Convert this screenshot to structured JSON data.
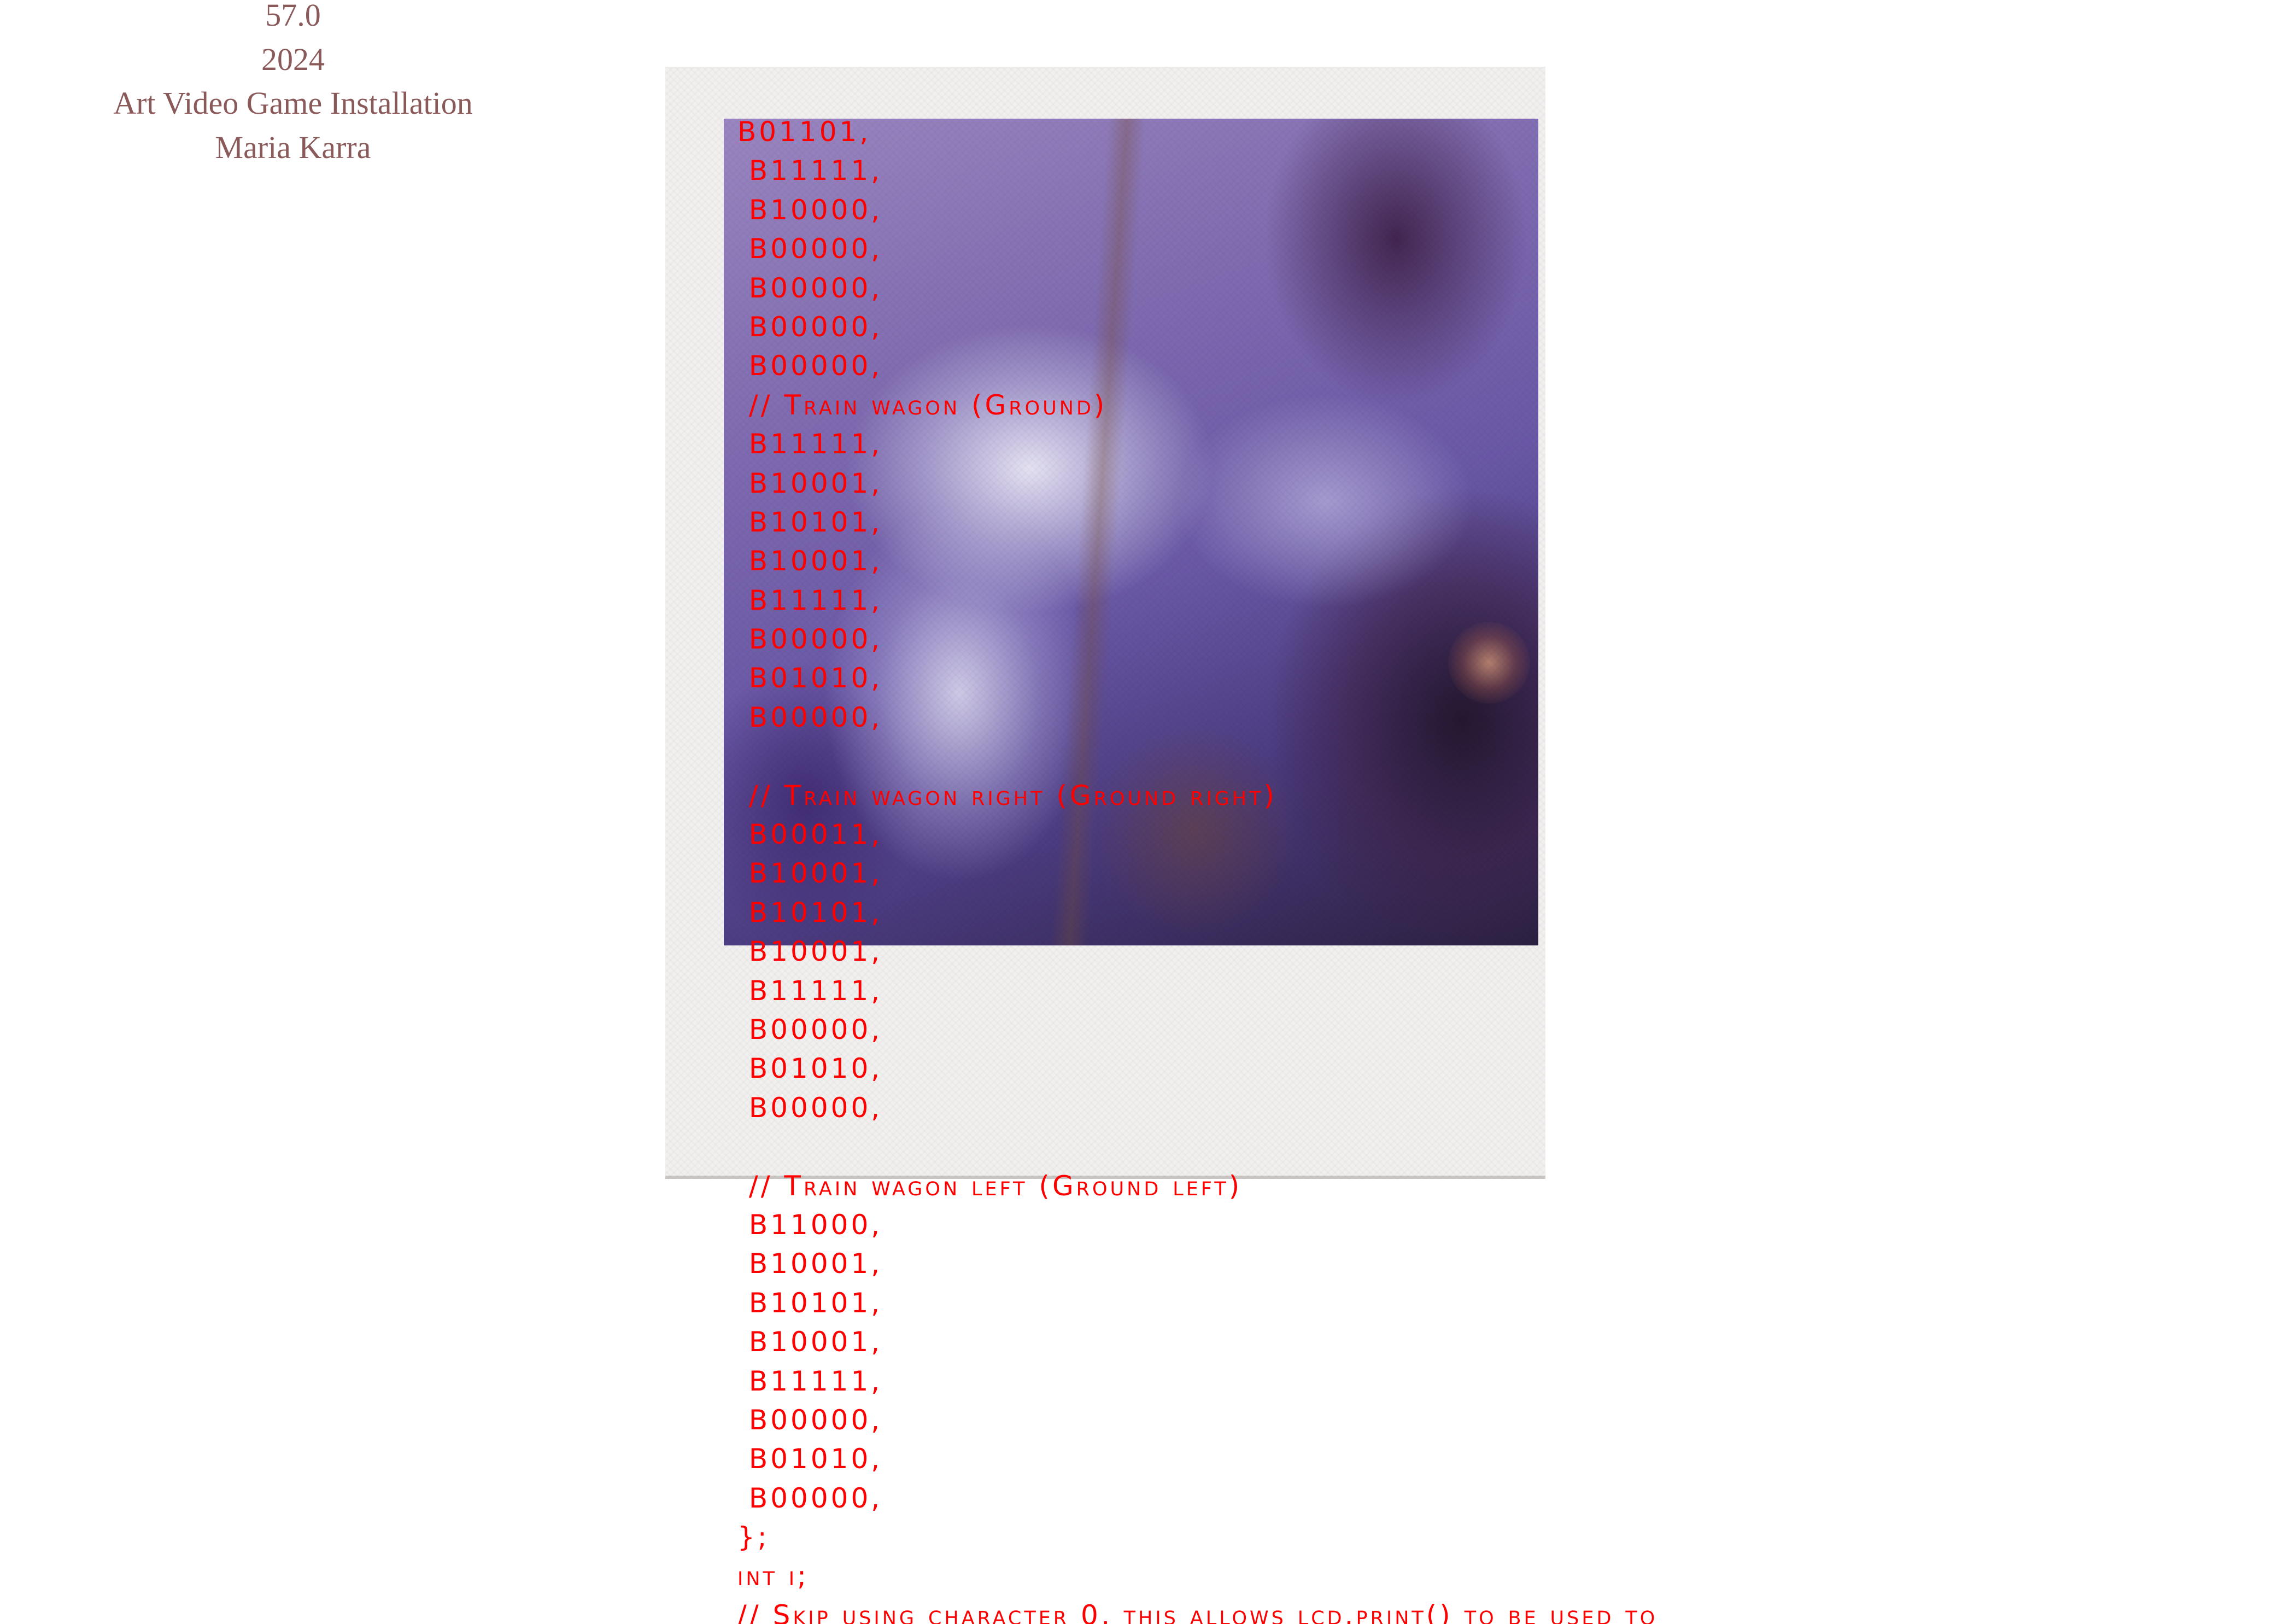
{
  "meta": {
    "number": "57.0",
    "year": "2024",
    "title": "Art Video Game Installation",
    "artist": "Maria Karra"
  },
  "code_lines": [
    "B01101,",
    " B11111,",
    " B10000,",
    " B00000,",
    " B00000,",
    " B00000,",
    " B00000,",
    " // Train wagon (Ground)",
    " B11111,",
    " B10001,",
    " B10101,",
    " B10001,",
    " B11111,",
    " B00000,",
    " B01010,",
    " B00000,",
    "",
    " // Train wagon right (Ground right)",
    " B00011,",
    " B10001,",
    " B10101,",
    " B10001,",
    " B11111,",
    " B00000,",
    " B01010,",
    " B00000,",
    "",
    " // Train wagon left (Ground left)",
    " B11000,",
    " B10001,",
    " B10101,",
    " B10001,",
    " B11111,",
    " B00000,",
    " B01010,",
    " B00000,",
    "};",
    "int i;",
    "// Skip using character 0, this allows lcd.print() to be used to"
  ],
  "colors": {
    "code_text": "#ff0000",
    "meta_text": "#8a5a5a",
    "background": "#ffffff"
  }
}
